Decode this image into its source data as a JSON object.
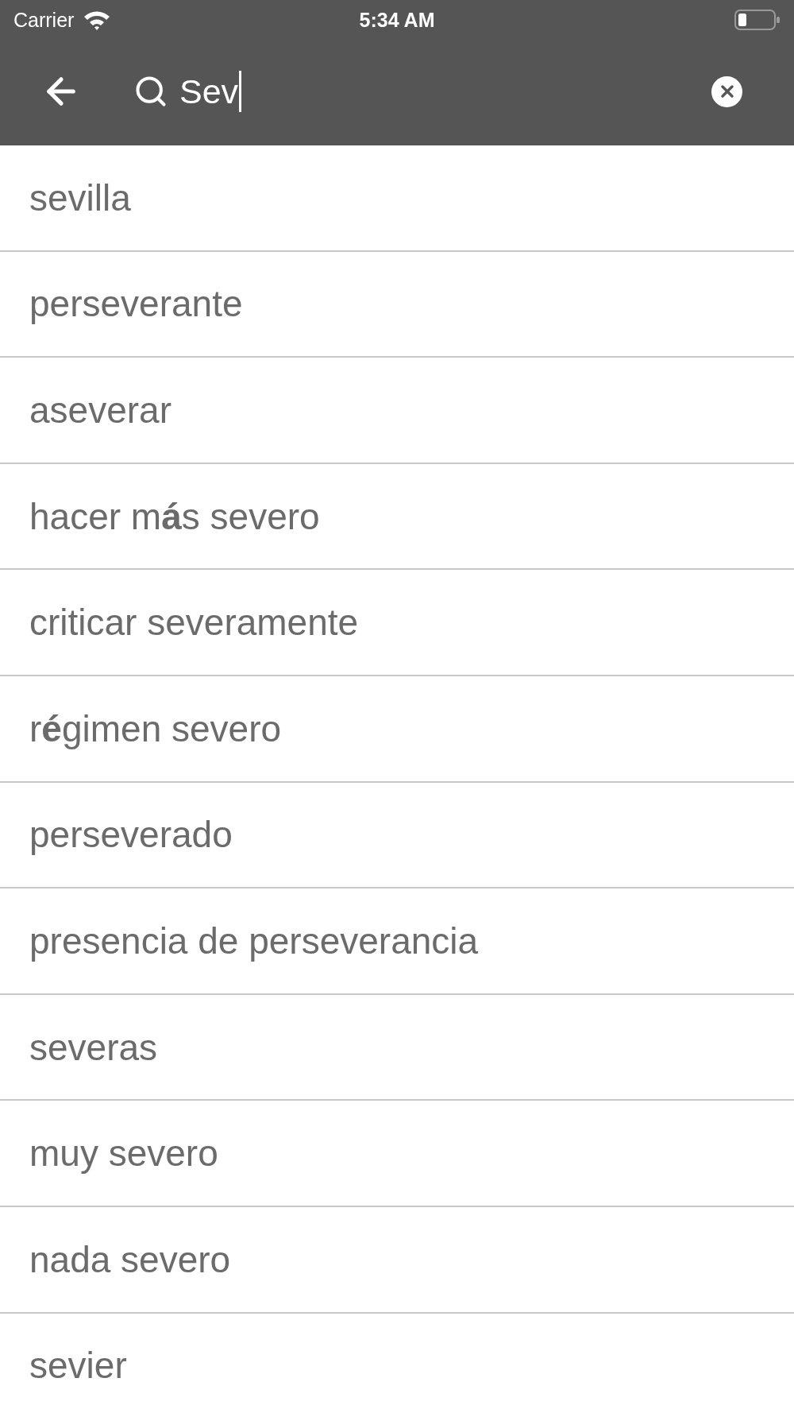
{
  "status_bar": {
    "carrier": "Carrier",
    "time": "5:34 AM"
  },
  "search_bar": {
    "value": "Sev",
    "focused": true
  },
  "results": [
    "sevilla",
    "perseverante",
    "aseverar",
    "hacer m**á**s severo",
    "criticar severamente",
    "r**é**gimen severo",
    "perseverado",
    "presencia de perseverancia",
    "severas",
    "muy severo",
    "nada severo",
    "sevier"
  ]
}
